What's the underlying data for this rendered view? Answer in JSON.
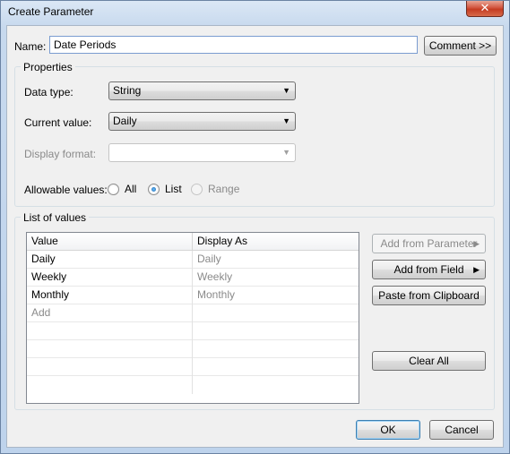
{
  "window": {
    "title": "Create Parameter",
    "close_label": "✕"
  },
  "name": {
    "label": "Name:",
    "value": "Date Periods",
    "comment_button": "Comment >>"
  },
  "properties": {
    "title": "Properties",
    "data_type": {
      "label": "Data type:",
      "value": "String"
    },
    "current_value": {
      "label": "Current value:",
      "value": "Daily"
    },
    "display_format": {
      "label": "Display format:",
      "value": ""
    },
    "allowable_values": {
      "label": "Allowable values:",
      "options": [
        "All",
        "List",
        "Range"
      ],
      "selected": "List"
    }
  },
  "list_of_values": {
    "title": "List of values",
    "columns": [
      "Value",
      "Display As"
    ],
    "rows": [
      {
        "value": "Daily",
        "display": "Daily"
      },
      {
        "value": "Weekly",
        "display": "Weekly"
      },
      {
        "value": "Monthly",
        "display": "Monthly"
      }
    ],
    "add_placeholder": "Add"
  },
  "side_buttons": {
    "add_from_parameter": "Add from Parameter",
    "add_from_field": "Add from Field",
    "paste_from_clipboard": "Paste from Clipboard",
    "clear_all": "Clear All"
  },
  "footer": {
    "ok": "OK",
    "cancel": "Cancel"
  }
}
